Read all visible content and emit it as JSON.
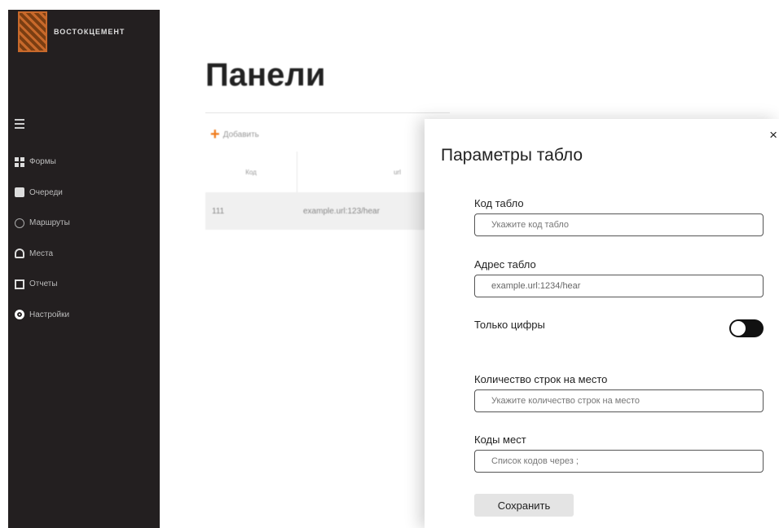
{
  "sidebar": {
    "logo_text": "ВОСТОКЦЕМЕНТ",
    "items": [
      {
        "icon": "forms-icon",
        "label": "Формы"
      },
      {
        "icon": "queues-icon",
        "label": "Очереди"
      },
      {
        "icon": "routes-icon",
        "label": "Маршруты"
      },
      {
        "icon": "places-icon",
        "label": "Места"
      },
      {
        "icon": "reports-icon",
        "label": "Отчеты"
      },
      {
        "icon": "settings-icon",
        "label": "Настройки"
      }
    ]
  },
  "main": {
    "title": "Панели",
    "add_label": "Добавить",
    "table": {
      "columns": [
        "Код",
        "url"
      ],
      "rows": [
        [
          "111",
          "example.url:123/hear"
        ]
      ]
    }
  },
  "drawer": {
    "title": "Параметры табло",
    "close": "×",
    "fields": [
      {
        "label": "Код табло",
        "value": "",
        "placeholder": "Укажите код табло"
      },
      {
        "label": "Адрес табло",
        "value": "example.url:1234/hear",
        "placeholder": ""
      },
      {
        "label": "Количество строк на место",
        "value": "",
        "placeholder": "Укажите количество строк на место"
      },
      {
        "label": "Коды мест",
        "value": "",
        "placeholder": "Список кодов через ;"
      }
    ],
    "toggle": {
      "label": "Только цифры",
      "on": false
    },
    "save_label": "Сохранить"
  },
  "colors": {
    "accent": "#f07a1a",
    "sidebar_bg": "#231f20",
    "toggle_bg": "#111111"
  }
}
